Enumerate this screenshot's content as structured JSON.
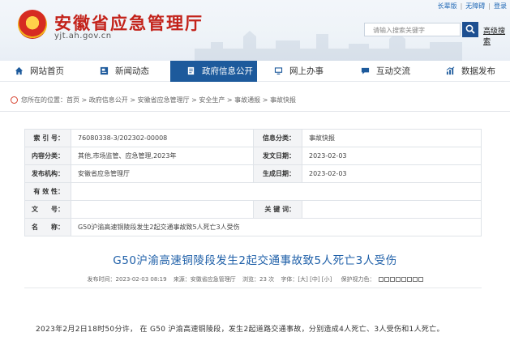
{
  "header": {
    "title": "安徽省应急管理厅",
    "url": "yjt.ah.gov.cn",
    "top_links": [
      "长辈版",
      "无障碍",
      "登录"
    ],
    "search_placeholder": "请输入搜索关键字",
    "advanced_search": "高级搜索"
  },
  "nav": {
    "items": [
      {
        "label": "网站首页",
        "icon": "home-icon"
      },
      {
        "label": "新闻动态",
        "icon": "news-icon"
      },
      {
        "label": "政府信息公开",
        "icon": "document-icon",
        "active": true
      },
      {
        "label": "网上办事",
        "icon": "monitor-icon"
      },
      {
        "label": "互动交流",
        "icon": "chat-icon"
      },
      {
        "label": "数据发布",
        "icon": "chart-icon"
      }
    ]
  },
  "breadcrumb": {
    "prefix": "您所在的位置：",
    "path": "首页 > 政府信息公开 > 安徽省应急管理厅 > 安全生产 > 事故通报 > 事故快报"
  },
  "info": {
    "index_label": "索 引 号：",
    "index_value": "76080338-3/202302-00008",
    "category_label": "信息分类：",
    "category_value": "事故快报",
    "content_label": "内容分类：",
    "content_value": "其他,市场监管、应急管理,2023年",
    "date_label": "发文日期：",
    "date_value": "2023-02-03",
    "publisher_label": "发布机构：",
    "publisher_value": "安徽省应急管理厅",
    "effective_label": "生成日期：",
    "effective_value": "2023-02-03",
    "validity_label": "有 效 性：",
    "validity_value": "",
    "docno_label": "文　　号：",
    "docno_value": "",
    "keywords_label": "关 键 词：",
    "keywords_value": "",
    "name_label": "名　　称：",
    "name_value": "G50沪渝高速铜陵段发生2起交通事故致5人死亡3人受伤"
  },
  "article": {
    "title": "G50沪渝高速铜陵段发生2起交通事故致5人死亡3人受伤",
    "publish_time": "发布时间：2023-02-03 08:19",
    "source": "来源：安徽省应急管理厅",
    "views": "浏览：23 次",
    "font_size": "字体：[大] [中] [小]",
    "eye_care": "保护视力色：",
    "body": "2023年2月2日18时50分许， 在 G50 沪渝高速铜陵段，发生2起道路交通事故，分别造成4人死亡、3人受伤和1人死亡。"
  },
  "colors": {
    "brand_red": "#c3221a",
    "nav_active": "#1d5a9c",
    "title_blue": "#1e5fa8"
  }
}
